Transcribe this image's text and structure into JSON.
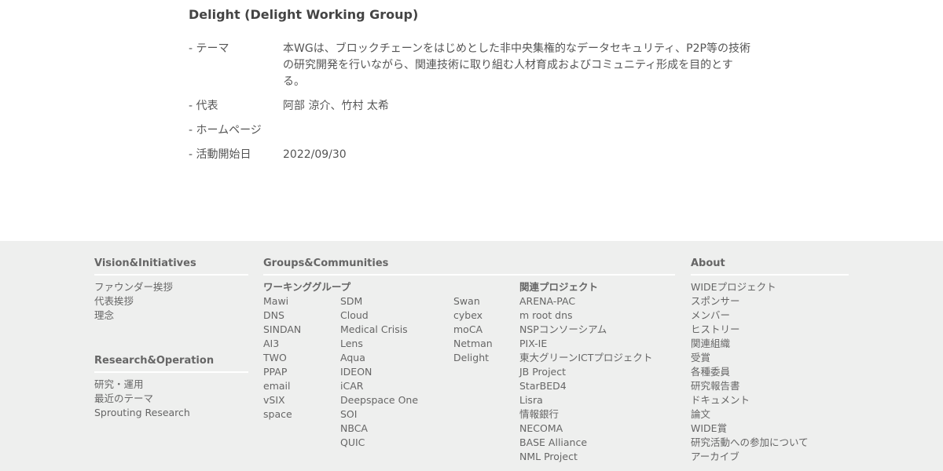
{
  "wg": {
    "title": "Delight (Delight Working Group)",
    "rows": [
      {
        "label": "- テーマ",
        "value": "本WGは、ブロックチェーンをはじめとした非中央集権的なデータセキュリティ、P2P等の技術の研究開発を行いながら、関連技術に取り組む人材育成およびコミュニティ形成を目的とする。"
      },
      {
        "label": "- 代表",
        "value": "阿部 涼介、竹村 太希"
      },
      {
        "label": "- ホームページ",
        "value": ""
      },
      {
        "label": "- 活動開始日",
        "value": "2022/09/30"
      }
    ]
  },
  "footer": {
    "vision": {
      "heading": "Vision&Initiatives",
      "items": [
        "ファウンダー挨拶",
        "代表挨拶",
        "理念"
      ]
    },
    "research": {
      "heading": "Research&Operation",
      "items": [
        "研究・運用",
        "最近のテーマ",
        "Sprouting Research"
      ]
    },
    "groups": {
      "heading": "Groups&Communities",
      "wg_heading": "ワーキンググループ",
      "wg_col1": [
        "Mawi",
        "DNS",
        "SINDAN",
        "AI3",
        "TWO",
        "PPAP",
        "email",
        "vSIX",
        "space"
      ],
      "wg_col2": [
        "SDM",
        "Cloud",
        "Medical Crisis",
        "Lens",
        "Aqua",
        "IDEON",
        "iCAR",
        "Deepspace One",
        "SOI",
        "NBCA",
        "QUIC"
      ],
      "wg_col3": [
        "Swan",
        "cybex",
        "moCA",
        "Netman",
        "Delight"
      ],
      "related_heading": "関連プロジェクト",
      "related": [
        "ARENA-PAC",
        "m root dns",
        "NSPコンソーシアム",
        "PIX-IE",
        "東大グリーンICTプロジェクト",
        "JB Project",
        "StarBED4",
        "Lisra",
        "情報銀行",
        "NECOMA",
        "BASE Alliance",
        "NML Project"
      ]
    },
    "about": {
      "heading": "About",
      "items": [
        "WIDEプロジェクト",
        "スポンサー",
        "メンバー",
        "ヒストリー",
        "関連組織",
        "受賞",
        "各種委員",
        "研究報告書",
        "ドキュメント",
        "論文",
        "WIDE賞",
        "研究活動への参加について",
        "アーカイブ"
      ]
    }
  }
}
